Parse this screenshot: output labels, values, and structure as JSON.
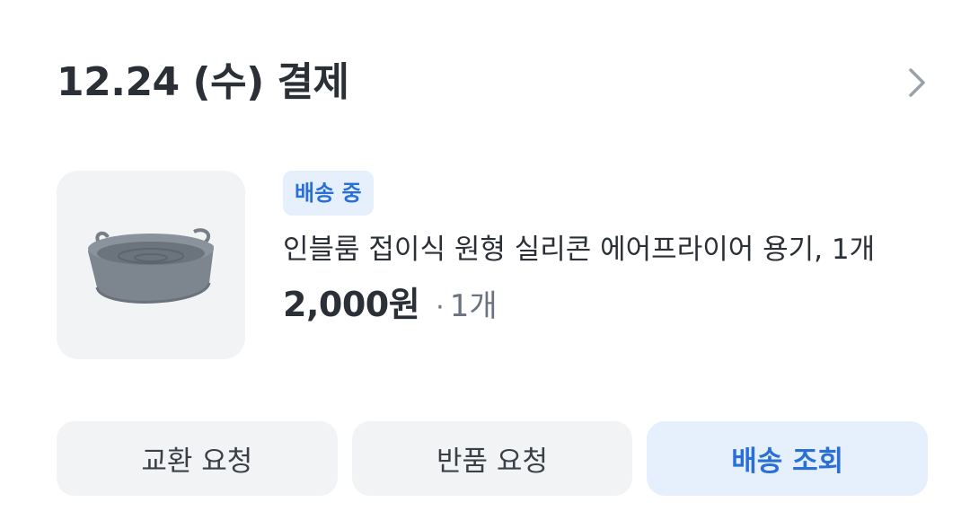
{
  "order": {
    "title": "12.24 (수) 결제"
  },
  "product": {
    "image_alt": "silicone-air-fryer-basket",
    "status_badge": "배송 중",
    "name": "인블룸 접이식 원형 실리콘 에어프라이어 용기, 1개",
    "price": "2,000원",
    "separator": "·",
    "quantity": "1개"
  },
  "actions": {
    "exchange_label": "교환 요청",
    "return_label": "반품 요청",
    "tracking_label": "배송 조회"
  },
  "colors": {
    "accent": "#2a6fd6",
    "accent_bg": "#e6f0fd",
    "button_bg": "#f2f3f5",
    "text": "#2b2f36",
    "muted": "#6b7280"
  },
  "icons": {
    "header_chevron": "chevron-right-icon"
  }
}
